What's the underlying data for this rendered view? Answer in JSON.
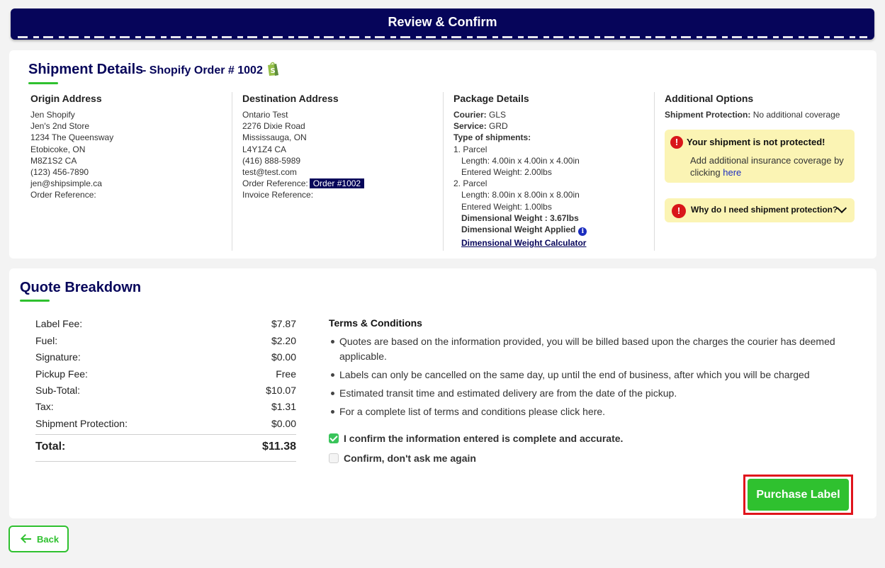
{
  "header": {
    "title": "Review & Confirm"
  },
  "shipment": {
    "title": "Shipment Details",
    "subtitle": "- Shopify Order # 1002",
    "origin": {
      "heading": "Origin Address",
      "lines": [
        "Jen Shopify",
        "Jen's 2nd Store",
        "1234 The Queensway",
        "Etobicoke, ON",
        "M8Z1S2 CA",
        "(123) 456-7890",
        "jen@shipsimple.ca",
        "Order Reference:"
      ]
    },
    "destination": {
      "heading": "Destination Address",
      "lines": [
        "Ontario Test",
        "2276 Dixie Road",
        "Mississauga, ON",
        "L4Y1Z4 CA",
        "(416) 888-5989",
        "test@test.com"
      ],
      "order_ref_label": "Order Reference:",
      "order_ref_value": "Order #1002",
      "invoice_ref_label": "Invoice Reference:"
    },
    "package": {
      "heading": "Package Details",
      "courier_label": "Courier:",
      "courier": "GLS",
      "service_label": "Service:",
      "service": "GRD",
      "types_label": "Type of shipments:",
      "parcel1": "1. Parcel",
      "parcel1_length": "Length: 4.00in x 4.00in x 4.00in",
      "parcel1_weight": "Entered Weight: 2.00lbs",
      "parcel2": "2. Parcel",
      "parcel2_length": "Length: 8.00in x 8.00in x 8.00in",
      "parcel2_weight": "Entered Weight: 1.00lbs",
      "dim_weight": "Dimensional Weight : 3.67lbs",
      "dim_applied": "Dimensional Weight Applied",
      "calculator_link": "Dimensional Weight Calculator"
    },
    "options": {
      "heading": "Additional Options",
      "protection_label": "Shipment Protection:",
      "protection_value": "No additional coverage",
      "warning_title": "Your shipment is not protected!",
      "warning_body": "Add additional insurance coverage by clicking",
      "warning_link": "here",
      "faq": "Why do I need shipment protection?"
    }
  },
  "quote": {
    "title": "Quote Breakdown",
    "fees": [
      {
        "label": "Label Fee:",
        "value": "$7.87"
      },
      {
        "label": "Fuel:",
        "value": "$2.20"
      },
      {
        "label": "Signature:",
        "value": "$0.00"
      },
      {
        "label": "Pickup Fee:",
        "value": "Free"
      },
      {
        "label": "Sub-Total:",
        "value": "$10.07"
      },
      {
        "label": "Tax:",
        "value": "$1.31"
      },
      {
        "label": "Shipment Protection:",
        "value": "$0.00"
      }
    ],
    "total_label": "Total:",
    "total_value": "$11.38"
  },
  "terms": {
    "heading": "Terms & Conditions",
    "items": [
      "Quotes are based on the information provided, you will be billed based upon the charges the courier has deemed applicable.",
      "Labels can only be cancelled on the same day, up until the end of business, after which you will be charged",
      "Estimated transit time and estimated delivery are from the date of the pickup.",
      "For a complete list of terms and conditions please click here."
    ],
    "confirm_label": "I confirm the information entered is complete and accurate.",
    "confirm_checked": true,
    "dont_ask_label": "Confirm, don't ask me again",
    "dont_ask_checked": false
  },
  "actions": {
    "purchase_label": "Purchase Label",
    "back_label": "Back"
  },
  "icons": {
    "shopify": "shopify-icon",
    "warning": "exclamation-icon",
    "info": "info-icon",
    "chevron": "chevron-down-icon",
    "back": "arrow-left-icon"
  },
  "colors": {
    "navy": "#06055a",
    "green": "#2fc12f",
    "warn_bg": "#fbf4b4",
    "red": "#d9161a"
  }
}
